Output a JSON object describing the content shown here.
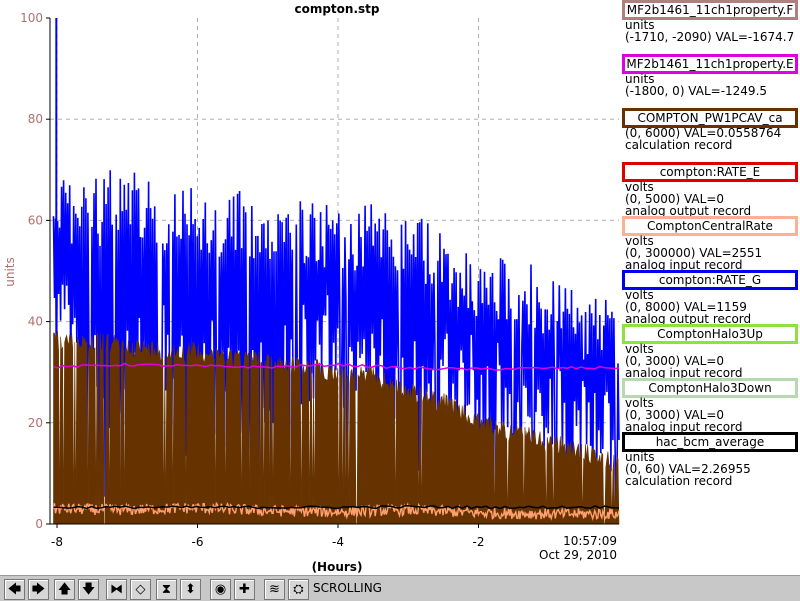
{
  "chart_data": {
    "type": "line",
    "title": "compton.stp",
    "xlabel": "(Hours)",
    "ylabel": "units",
    "xlim": [
      -8.1,
      0
    ],
    "ylim": [
      0,
      100
    ],
    "x_ticks": [
      -8,
      -6,
      -4,
      -2
    ],
    "x_tick_labels": [
      "-8",
      "-6",
      "-4",
      "-2"
    ],
    "y_ticks": [
      0,
      20,
      40,
      60,
      80,
      100
    ],
    "y_tick_labels": [
      "0",
      "20",
      "40",
      "60",
      "80",
      "100"
    ],
    "grid": true,
    "end_time": "10:57:09",
    "end_date": "Oct 29, 2010",
    "series": [
      {
        "name": "compton:RATE_G",
        "color": "#0000ff",
        "style": "dense-noise",
        "x": [
          -8.05,
          -7.5,
          -7.0,
          -6.5,
          -6.0,
          -5.5,
          -5.0,
          -4.5,
          -4.0,
          -3.5,
          -3.0,
          -2.5,
          -2.0,
          -1.5,
          -1.0,
          -0.5,
          0.0
        ],
        "y_high": [
          70,
          68,
          72,
          68,
          68,
          66,
          66,
          64,
          63,
          64,
          62,
          58,
          52,
          54,
          50,
          46,
          45
        ],
        "y_low": [
          30,
          0,
          5,
          10,
          12,
          15,
          0,
          14,
          20,
          10,
          5,
          20,
          15,
          10,
          10,
          5,
          3
        ],
        "spikes": [
          {
            "x": -8.01,
            "y": 100
          }
        ]
      },
      {
        "name": "COMPTON_PW1PCAV_ca",
        "color": "#663300",
        "style": "filled-area",
        "x": [
          -8.05,
          -7.5,
          -7.0,
          -6.5,
          -6.0,
          -5.5,
          -5.0,
          -4.5,
          -4.0,
          -3.5,
          -3.0,
          -2.5,
          -2.0,
          -1.5,
          -1.0,
          -0.5,
          0.0
        ],
        "y": [
          38,
          38,
          37,
          36,
          36,
          35,
          34,
          33,
          32,
          31,
          28,
          26,
          22,
          20,
          18,
          16,
          14
        ]
      },
      {
        "name": "MF2b1461_11ch1property.E",
        "color": "#e000e0",
        "style": "line",
        "x": [
          -8.05,
          -7.0,
          -6.0,
          -5.0,
          -4.0,
          -3.0,
          -2.0,
          -1.0,
          0.0
        ],
        "y": [
          31.0,
          31.5,
          31.2,
          31.0,
          31.5,
          30.8,
          30.6,
          30.8,
          30.9
        ]
      },
      {
        "name": "ComptonCentralRate",
        "color": "#ffa070",
        "style": "noisy-line",
        "x": [
          -8.05,
          -7.0,
          -6.0,
          -5.0,
          -4.0,
          -3.0,
          -2.0,
          -1.0,
          0.0
        ],
        "y": [
          3.0,
          2.8,
          3.2,
          2.6,
          2.4,
          2.8,
          2.2,
          2.0,
          2.0
        ]
      },
      {
        "name": "hac_bcm_average",
        "color": "#000000",
        "style": "line",
        "x": [
          -8.05,
          -4.0,
          -3.0,
          -2.0,
          -1.0,
          0.0
        ],
        "y": [
          3.3,
          3.3,
          3.4,
          3.3,
          3.3,
          3.4
        ]
      }
    ],
    "legend": [
      {
        "name": "MF2b1461_11ch1property.F",
        "color": "#b08080",
        "units": "units",
        "range": "(-1710, -2090)",
        "val": "VAL=-1674.7",
        "record": ""
      },
      {
        "name": "MF2b1461_11ch1property.E",
        "color": "#e000e0",
        "units": "units",
        "range": "(-1800, 0)",
        "val": "VAL=-1249.5",
        "record": ""
      },
      {
        "name": "COMPTON_PW1PCAV_ca",
        "color": "#663300",
        "units": "",
        "range": "(0, 6000)",
        "val": "VAL=0.0558764",
        "record": "calculation record"
      },
      {
        "name": "compton:RATE_E",
        "color": "#dd0000",
        "units": "volts",
        "range": "(0, 5000)",
        "val": "VAL=0",
        "record": "analog output record"
      },
      {
        "name": "ComptonCentralRate",
        "color": "#ffb090",
        "units": "volts",
        "range": "(0, 300000)",
        "val": "VAL=2551",
        "record": "analog input record"
      },
      {
        "name": "compton:RATE_G",
        "color": "#0000ee",
        "units": "volts",
        "range": "(0, 8000)",
        "val": "VAL=1159",
        "record": "analog output record"
      },
      {
        "name": "ComptonHalo3Up",
        "color": "#90e040",
        "units": "volts",
        "range": "(0, 3000)",
        "val": "VAL=0",
        "record": "analog input record"
      },
      {
        "name": "ComptonHalo3Down",
        "color": "#b8d8b0",
        "units": "volts",
        "range": "(0, 3000)",
        "val": "VAL=0",
        "record": "analog input record"
      },
      {
        "name": "hac_bcm_average",
        "color": "#000000",
        "units": "units",
        "range": "(0, 60)",
        "val": "VAL=2.26955",
        "record": "calculation record"
      }
    ]
  },
  "toolbar": {
    "buttons": [
      {
        "name": "pan-left-button",
        "glyph": "🡄"
      },
      {
        "name": "pan-right-button",
        "glyph": "🡆"
      },
      {
        "name": "pan-up-button",
        "glyph": "🡅"
      },
      {
        "name": "pan-down-button",
        "glyph": "🡇"
      },
      {
        "name": "zoom-in-horizontal-button",
        "glyph": "⧓"
      },
      {
        "name": "zoom-out-horizontal-button",
        "glyph": "◇"
      },
      {
        "name": "zoom-in-vertical-button",
        "glyph": "⧗"
      },
      {
        "name": "zoom-out-vertical-button",
        "glyph": "⬍"
      },
      {
        "name": "auto-scale-button",
        "glyph": "◉"
      },
      {
        "name": "add-channel-button",
        "glyph": "✚"
      },
      {
        "name": "stagger-button",
        "glyph": "≋"
      },
      {
        "name": "config-button",
        "glyph": "⛭"
      }
    ],
    "mode_label": "SCROLLING"
  }
}
